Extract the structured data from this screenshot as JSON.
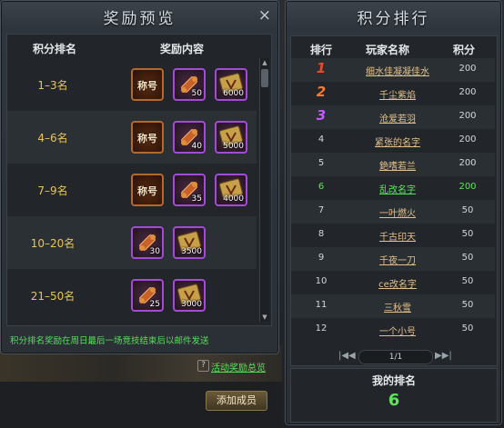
{
  "reward_panel": {
    "title": "奖励预览",
    "close_icon": "×",
    "col_rank": "积分排名",
    "col_reward": "奖励内容",
    "rows": [
      {
        "rank": "1–3名",
        "items": [
          {
            "type": "title",
            "label": "称号",
            "qty": ""
          },
          {
            "type": "scroll",
            "label": "",
            "qty": "50"
          },
          {
            "type": "box",
            "label": "",
            "qty": "6000"
          }
        ]
      },
      {
        "rank": "4–6名",
        "items": [
          {
            "type": "title",
            "label": "称号",
            "qty": ""
          },
          {
            "type": "scroll",
            "label": "",
            "qty": "40"
          },
          {
            "type": "box",
            "label": "",
            "qty": "5000"
          }
        ]
      },
      {
        "rank": "7–9名",
        "items": [
          {
            "type": "title",
            "label": "称号",
            "qty": ""
          },
          {
            "type": "scroll",
            "label": "",
            "qty": "35"
          },
          {
            "type": "box",
            "label": "",
            "qty": "4000"
          }
        ]
      },
      {
        "rank": "10–20名",
        "items": [
          {
            "type": "scroll",
            "label": "",
            "qty": "30"
          },
          {
            "type": "box",
            "label": "",
            "qty": "3500"
          }
        ]
      },
      {
        "rank": "21–50名",
        "items": [
          {
            "type": "scroll",
            "label": "",
            "qty": "25"
          },
          {
            "type": "box",
            "label": "",
            "qty": "3000"
          }
        ]
      }
    ],
    "note": "积分排名奖励在周日最后一场竞技结束后以邮件发送",
    "help_icon": "?",
    "help_link": "活动奖励总览",
    "add_member_button": "添加成员"
  },
  "ranking_panel": {
    "title": "积分排行",
    "col_rank": "排行",
    "col_name": "玩家名称",
    "col_score": "积分",
    "rows": [
      {
        "rank": "1",
        "name": "细水佳凝凝佳水",
        "score": "200"
      },
      {
        "rank": "2",
        "name": "千尘紫焰",
        "score": "200"
      },
      {
        "rank": "3",
        "name": "沧爱若羽",
        "score": "200"
      },
      {
        "rank": "4",
        "name": "紧张的名字",
        "score": "200"
      },
      {
        "rank": "5",
        "name": "銫嗜若兰",
        "score": "200"
      },
      {
        "rank": "6",
        "name": "乱改名字",
        "score": "200"
      },
      {
        "rank": "7",
        "name": "一叶燃火",
        "score": "50"
      },
      {
        "rank": "8",
        "name": "千古印天",
        "score": "50"
      },
      {
        "rank": "9",
        "name": "千夜一刀",
        "score": "50"
      },
      {
        "rank": "10",
        "name": "ce改名字",
        "score": "50"
      },
      {
        "rank": "11",
        "name": "三秋雪",
        "score": "50"
      },
      {
        "rank": "12",
        "name": "一个小号",
        "score": "50"
      }
    ],
    "pager": {
      "first": "|◀◀",
      "next": "▶▶|",
      "text": "1/1"
    },
    "my_rank_label": "我的排名",
    "my_rank_value": "6",
    "colors": {
      "gold": "#e6c45b",
      "green": "#5fe35d",
      "rank1": "#e84a2e",
      "rank2": "#ff7a2c",
      "rank3": "#c45bff"
    }
  }
}
